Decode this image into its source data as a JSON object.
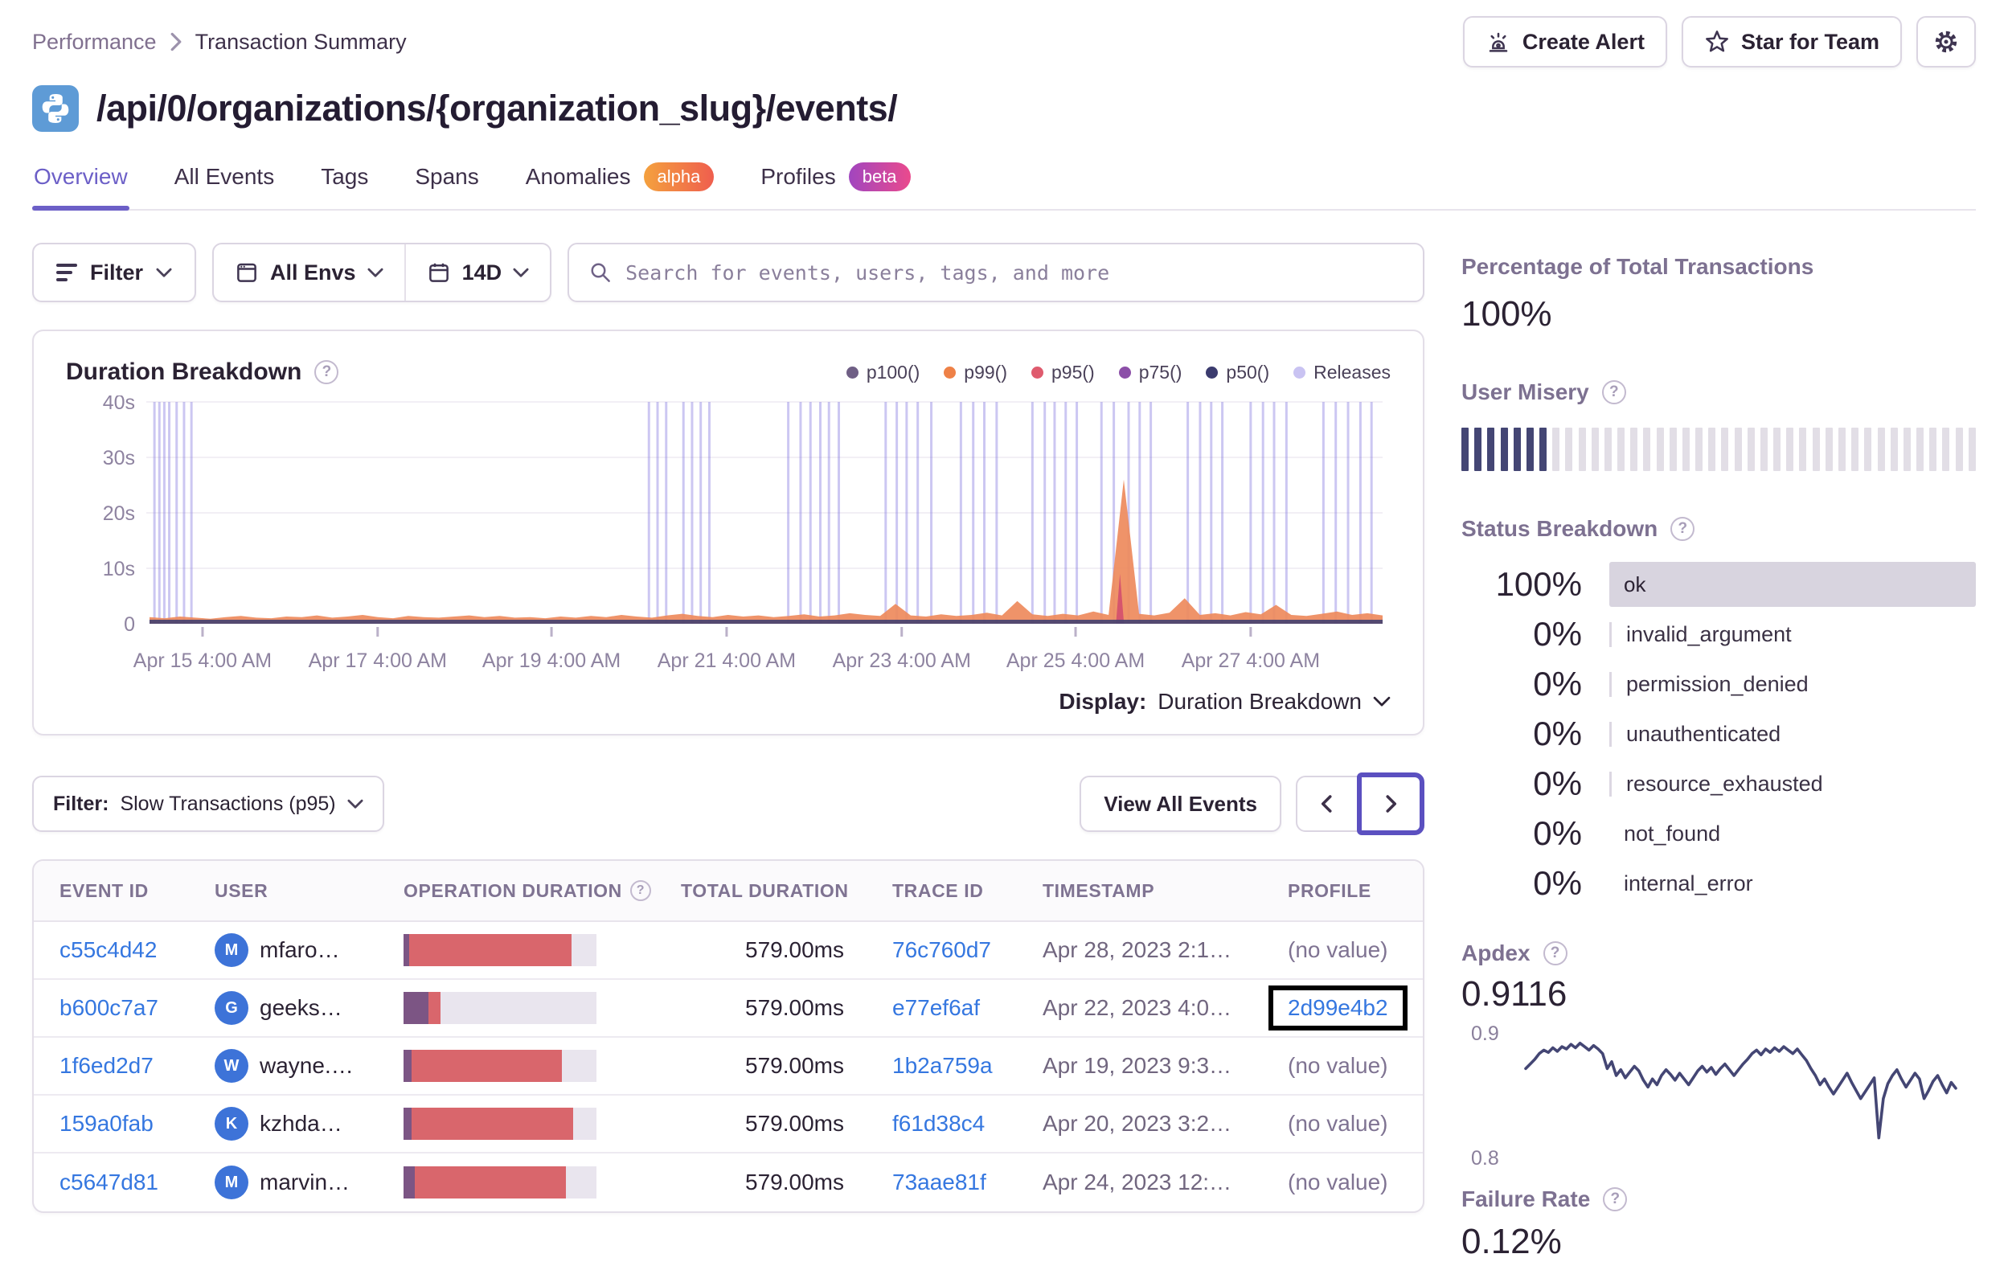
{
  "page": {
    "breadcrumb": [
      "Performance",
      "Transaction Summary"
    ],
    "title": "/api/0/organizations/{organization_slug}/events/"
  },
  "header": {
    "create_alert": "Create Alert",
    "star_for_team": "Star for Team"
  },
  "tabs": [
    {
      "label": "Overview",
      "active": true
    },
    {
      "label": "All Events"
    },
    {
      "label": "Tags"
    },
    {
      "label": "Spans"
    },
    {
      "label": "Anomalies",
      "badge": "alpha"
    },
    {
      "label": "Profiles",
      "badge": "beta"
    }
  ],
  "filter_bar": {
    "filter_label": "Filter",
    "envs": "All Envs",
    "date": "14D",
    "search_placeholder": "Search for events, users, tags, and more"
  },
  "chart_panel": {
    "title": "Duration Breakdown",
    "display_label": "Display:",
    "display_value": "Duration Breakdown"
  },
  "chart_data": [
    {
      "id": "duration_breakdown",
      "type": "area",
      "title": "Duration Breakdown",
      "ylim": [
        0,
        40
      ],
      "y_ticks": [
        {
          "v": 0,
          "label": "0"
        },
        {
          "v": 10,
          "label": "10s"
        },
        {
          "v": 20,
          "label": "20s"
        },
        {
          "v": 30,
          "label": "30s"
        },
        {
          "v": 40,
          "label": "40s"
        }
      ],
      "x_ticks": [
        "Apr 15 4:00 AM",
        "Apr 17 4:00 AM",
        "Apr 19 4:00 AM",
        "Apr 21 4:00 AM",
        "Apr 23 4:00 AM",
        "Apr 25 4:00 AM",
        "Apr 27 4:00 AM"
      ],
      "x_tick_fractions": [
        0.043,
        0.185,
        0.326,
        0.468,
        0.61,
        0.751,
        0.893
      ],
      "grid": true,
      "legend": [
        {
          "label": "p100()",
          "color": "#6F5F85"
        },
        {
          "label": "p99()",
          "color": "#EE8147"
        },
        {
          "label": "p95()",
          "color": "#DF5B6E"
        },
        {
          "label": "p75()",
          "color": "#8C4FA8"
        },
        {
          "label": "p50()",
          "color": "#3B3B6E"
        },
        {
          "label": "Releases",
          "color": "#C9C3F2"
        }
      ],
      "series": [
        {
          "name": "p99()",
          "color": "#EE8A5C",
          "values": [
            1.2,
            1.0,
            1.3,
            1.1,
            0.9,
            1.2,
            1.4,
            1.1,
            1.0,
            1.3,
            1.2,
            1.5,
            1.1,
            1.3,
            1.6,
            1.2,
            1.0,
            1.4,
            1.2,
            1.1,
            1.3,
            1.5,
            1.2,
            1.4,
            1.1,
            1.2,
            1.0,
            1.3,
            1.1,
            1.4,
            1.2,
            1.6,
            1.3,
            1.1,
            1.5,
            1.8,
            1.4,
            1.2,
            1.6,
            1.3,
            1.5,
            1.2,
            1.4,
            1.7,
            1.3,
            1.5,
            1.9,
            1.6,
            1.4,
            3.6,
            1.5,
            1.3,
            1.7,
            1.4,
            1.6,
            2.0,
            1.5,
            4.1,
            1.7,
            1.4,
            1.8,
            1.5,
            2.2,
            1.6,
            26.0,
            1.8,
            1.5,
            2.0,
            4.6,
            1.6,
            1.9,
            1.5,
            2.1,
            1.7,
            3.4,
            1.6,
            1.4,
            1.8,
            2.2,
            1.6,
            1.9,
            1.5
          ]
        },
        {
          "name": "p50()",
          "color": "#4B4571",
          "baseline": 0.5
        }
      ],
      "p95_spike": {
        "fraction": 0.787,
        "value": 9,
        "color": "#D6556D"
      },
      "releases": {
        "color": "#8679E0",
        "fractions": [
          0.004,
          0.008,
          0.012,
          0.016,
          0.022,
          0.028,
          0.034,
          0.405,
          0.412,
          0.419,
          0.433,
          0.44,
          0.447,
          0.454,
          0.518,
          0.528,
          0.536,
          0.544,
          0.551,
          0.559,
          0.597,
          0.606,
          0.614,
          0.623,
          0.634,
          0.658,
          0.668,
          0.677,
          0.687,
          0.716,
          0.726,
          0.734,
          0.743,
          0.752,
          0.772,
          0.782,
          0.794,
          0.803,
          0.812,
          0.842,
          0.852,
          0.861,
          0.87,
          0.893,
          0.903,
          0.912,
          0.922,
          0.952,
          0.962,
          0.972,
          0.982,
          0.991
        ]
      }
    },
    {
      "id": "apdex_trend",
      "type": "line",
      "color": "#444674",
      "ylim": [
        0.795,
        0.905
      ],
      "y_labels": [
        "0.9",
        "0.8"
      ],
      "values": [
        0.872,
        0.876,
        0.88,
        0.885,
        0.888,
        0.886,
        0.89,
        0.887,
        0.891,
        0.889,
        0.893,
        0.89,
        0.894,
        0.891,
        0.888,
        0.892,
        0.889,
        0.885,
        0.872,
        0.878,
        0.866,
        0.871,
        0.864,
        0.869,
        0.874,
        0.87,
        0.862,
        0.856,
        0.863,
        0.858,
        0.866,
        0.871,
        0.867,
        0.862,
        0.868,
        0.863,
        0.858,
        0.864,
        0.87,
        0.874,
        0.869,
        0.873,
        0.867,
        0.872,
        0.876,
        0.871,
        0.866,
        0.871,
        0.876,
        0.88,
        0.885,
        0.888,
        0.884,
        0.889,
        0.886,
        0.89,
        0.887,
        0.891,
        0.888,
        0.885,
        0.889,
        0.884,
        0.879,
        0.872,
        0.866,
        0.858,
        0.863,
        0.856,
        0.85,
        0.856,
        0.862,
        0.868,
        0.86,
        0.853,
        0.846,
        0.852,
        0.858,
        0.864,
        0.812,
        0.846,
        0.859,
        0.866,
        0.871,
        0.863,
        0.856,
        0.862,
        0.868,
        0.863,
        0.846,
        0.853,
        0.861,
        0.866,
        0.858,
        0.851,
        0.86,
        0.855
      ]
    }
  ],
  "events_section": {
    "filter_label": "Filter:",
    "filter_value": "Slow Transactions (p95)",
    "view_all": "View All Events"
  },
  "table": {
    "columns": [
      "EVENT ID",
      "USER",
      "OPERATION DURATION",
      "TOTAL DURATION",
      "TRACE ID",
      "TIMESTAMP",
      "PROFILE"
    ],
    "rows": [
      {
        "event_id": "c55c4d42",
        "user_initial": "M",
        "user_name": "mfaro…",
        "op_purple": 3,
        "op_red": 84,
        "total": "579.00ms",
        "trace_id": "76c760d7",
        "timestamp": "Apr 28, 2023 2:1…",
        "profile": "(no value)",
        "profile_link": false,
        "profile_highlight": false
      },
      {
        "event_id": "b600c7a7",
        "user_initial": "G",
        "user_name": "geeks…",
        "op_purple": 13,
        "op_red": 6,
        "total": "579.00ms",
        "trace_id": "e77ef6af",
        "timestamp": "Apr 22, 2023 4:0…",
        "profile": "2d99e4b2",
        "profile_link": true,
        "profile_highlight": true
      },
      {
        "event_id": "1f6ed2d7",
        "user_initial": "W",
        "user_name": "wayne.…",
        "op_purple": 4,
        "op_red": 78,
        "total": "579.00ms",
        "trace_id": "1b2a759a",
        "timestamp": "Apr 19, 2023 9:3…",
        "profile": "(no value)",
        "profile_link": false,
        "profile_highlight": false
      },
      {
        "event_id": "159a0fab",
        "user_initial": "K",
        "user_name": "kzhda…",
        "op_purple": 4,
        "op_red": 84,
        "total": "579.00ms",
        "trace_id": "f61d38c4",
        "timestamp": "Apr 20, 2023 3:2…",
        "profile": "(no value)",
        "profile_link": false,
        "profile_highlight": false
      },
      {
        "event_id": "c5647d81",
        "user_initial": "M",
        "user_name": "marvin…",
        "op_purple": 6,
        "op_red": 78,
        "total": "579.00ms",
        "trace_id": "73aae81f",
        "timestamp": "Apr 24, 2023 12:…",
        "profile": "(no value)",
        "profile_link": false,
        "profile_highlight": false
      }
    ]
  },
  "sidebar": {
    "percent_total": {
      "label": "Percentage of Total Transactions",
      "value": "100%"
    },
    "user_misery": {
      "label": "User Misery",
      "bars_total": 40,
      "bars_filled": 7,
      "filled_color": "#444674",
      "empty_color": "#E2DEE6"
    },
    "status_breakdown": {
      "label": "Status Breakdown",
      "rows": [
        {
          "pct": "100%",
          "status": "ok",
          "bar": true,
          "divider": false
        },
        {
          "pct": "0%",
          "status": "invalid_argument",
          "bar": false,
          "divider": true
        },
        {
          "pct": "0%",
          "status": "permission_denied",
          "bar": false,
          "divider": true
        },
        {
          "pct": "0%",
          "status": "unauthenticated",
          "bar": false,
          "divider": true
        },
        {
          "pct": "0%",
          "status": "resource_exhausted",
          "bar": false,
          "divider": true
        },
        {
          "pct": "0%",
          "status": "not_found",
          "bar": false,
          "divider": false
        },
        {
          "pct": "0%",
          "status": "internal_error",
          "bar": false,
          "divider": false
        }
      ]
    },
    "apdex": {
      "label": "Apdex",
      "value": "0.9116"
    },
    "failure_rate": {
      "label": "Failure Rate",
      "value": "0.12%"
    }
  },
  "colors": {
    "accent_purple": "#6C5FC7",
    "link_blue": "#3577E0",
    "bar_red": "#D9666C",
    "bar_purple": "#7C5584",
    "release_line": "#8679E0",
    "highlight_black": "#000000"
  }
}
